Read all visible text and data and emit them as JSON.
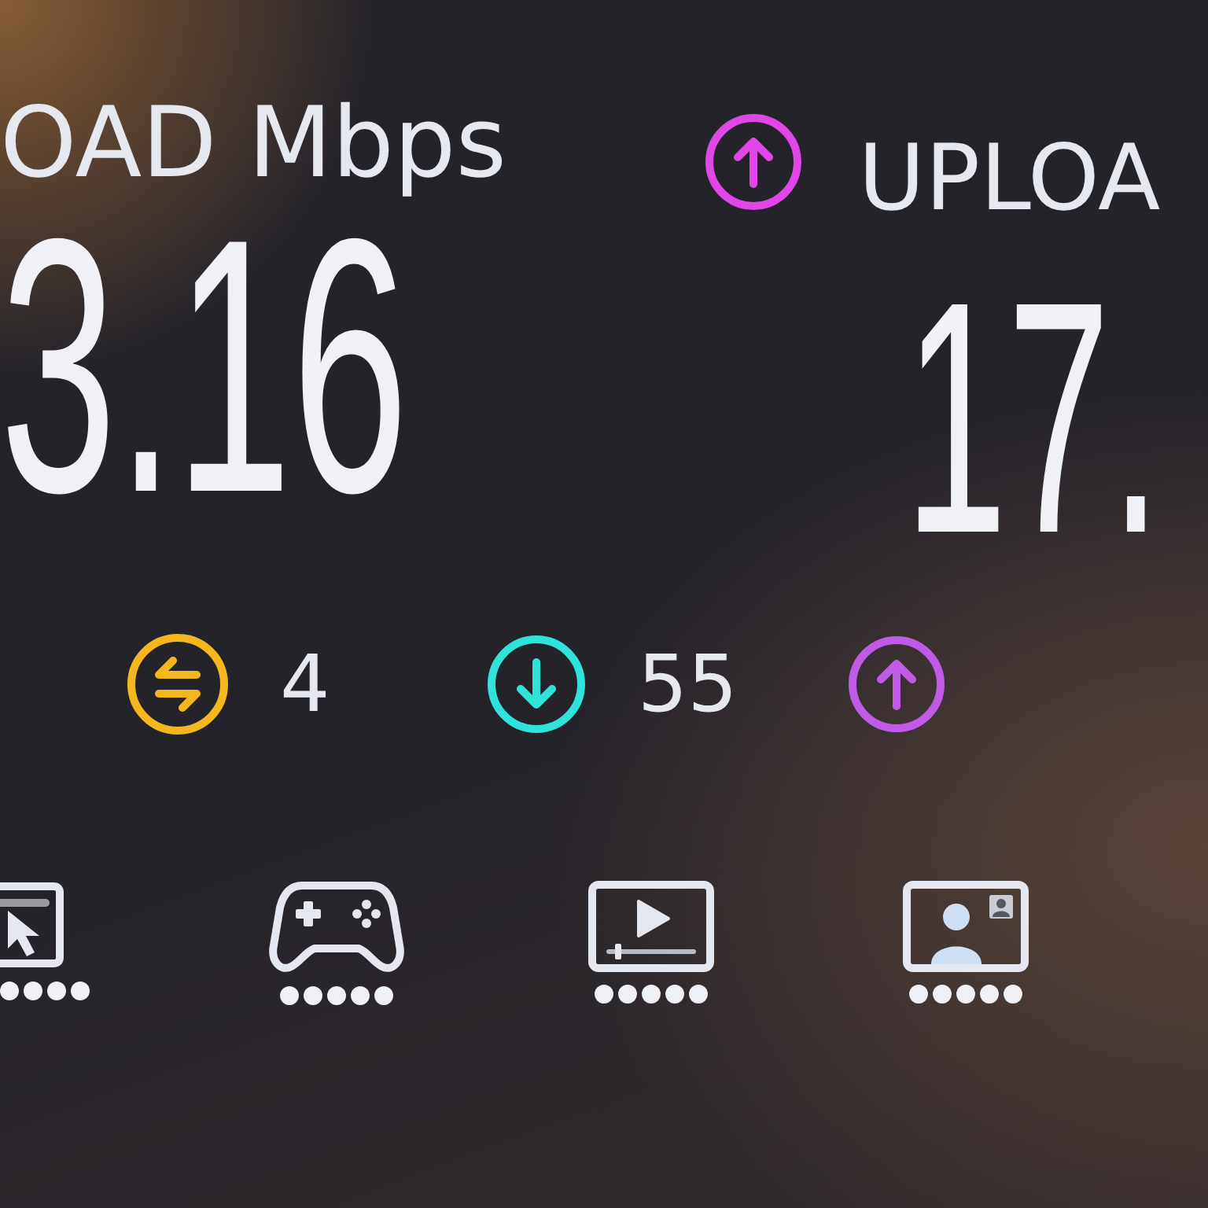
{
  "download": {
    "label": "OAD Mbps",
    "value": "3.16"
  },
  "upload": {
    "label": "UPLOA",
    "value": "17."
  },
  "latency": [
    {
      "kind": "idle",
      "value": "4",
      "color": "#f5b71e"
    },
    {
      "kind": "download",
      "value": "55",
      "color": "#2fe3da"
    },
    {
      "kind": "upload",
      "color": "#c25ae8"
    }
  ],
  "activities": [
    {
      "kind": "browsing",
      "stars": 4
    },
    {
      "kind": "gaming",
      "stars": 5
    },
    {
      "kind": "streaming",
      "stars": 5
    },
    {
      "kind": "video_call",
      "stars": 5
    }
  ]
}
